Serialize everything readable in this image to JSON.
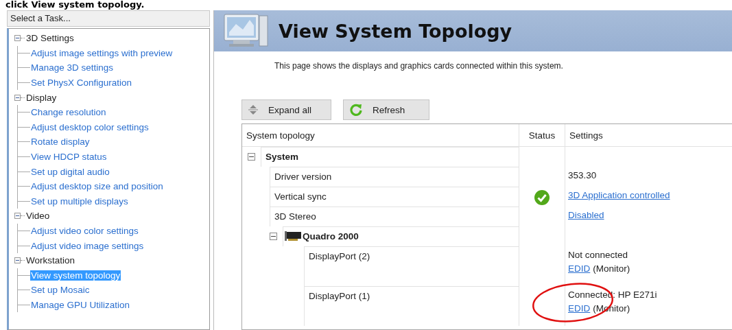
{
  "caption": "click View system topology.",
  "sidebar": {
    "title": "Select a Task...",
    "tree": [
      {
        "label": "3D Settings",
        "expanded": true,
        "children": [
          {
            "label": "Adjust image settings with preview",
            "selected": false
          },
          {
            "label": "Manage 3D settings",
            "selected": false
          },
          {
            "label": "Set PhysX Configuration",
            "selected": false
          }
        ]
      },
      {
        "label": "Display",
        "expanded": true,
        "children": [
          {
            "label": "Change resolution",
            "selected": false
          },
          {
            "label": "Adjust desktop color settings",
            "selected": false
          },
          {
            "label": "Rotate display",
            "selected": false
          },
          {
            "label": "View HDCP status",
            "selected": false
          },
          {
            "label": "Set up digital audio",
            "selected": false
          },
          {
            "label": "Adjust desktop size and position",
            "selected": false
          },
          {
            "label": "Set up multiple displays",
            "selected": false
          }
        ]
      },
      {
        "label": "Video",
        "expanded": true,
        "children": [
          {
            "label": "Adjust video color settings",
            "selected": false
          },
          {
            "label": "Adjust video image settings",
            "selected": false
          }
        ]
      },
      {
        "label": "Workstation",
        "expanded": true,
        "children": [
          {
            "label": "View system topology",
            "selected": true
          },
          {
            "label": "Set up Mosaic",
            "selected": false
          },
          {
            "label": "Manage GPU Utilization",
            "selected": false
          }
        ]
      }
    ]
  },
  "page": {
    "title": "View System Topology",
    "description": "This page shows the displays and graphics cards connected within this system."
  },
  "toolbar": [
    {
      "kind": "expand",
      "label": "Expand all"
    },
    {
      "kind": "refresh",
      "label": "Refresh"
    }
  ],
  "table": {
    "columns": [
      "System topology",
      "Status",
      "Settings"
    ],
    "rows": [
      {
        "kind": "system",
        "label": "System",
        "expanded": true,
        "children": [
          {
            "kind": "setting",
            "label": "Driver version",
            "status_ok": false,
            "settings": [
              [
                {
                  "kind": "text",
                  "text": "353.30"
                }
              ]
            ]
          },
          {
            "kind": "setting",
            "label": "Vertical sync",
            "status_ok": true,
            "settings": [
              [
                {
                  "kind": "link",
                  "text": "3D Application controlled"
                }
              ]
            ]
          },
          {
            "kind": "setting",
            "label": "3D Stereo",
            "status_ok": false,
            "settings": [
              [
                {
                  "kind": "link",
                  "text": "Disabled"
                }
              ]
            ]
          },
          {
            "kind": "gpu",
            "label": "Quadro 2000",
            "expanded": true,
            "children": [
              {
                "kind": "port",
                "label": "DisplayPort (2)",
                "status_ok": false,
                "settings": [
                  [
                    {
                      "kind": "text",
                      "text": "Not connected"
                    }
                  ],
                  [
                    {
                      "kind": "link",
                      "text": "EDID"
                    },
                    {
                      "kind": "text",
                      "text": "(Monitor)"
                    }
                  ]
                ]
              },
              {
                "kind": "port",
                "label": "DisplayPort (1)",
                "status_ok": false,
                "settings": [
                  [
                    {
                      "kind": "text",
                      "text": "Connected: HP E271i"
                    }
                  ],
                  [
                    {
                      "kind": "link",
                      "text": "EDID"
                    },
                    {
                      "kind": "text",
                      "text": "(Monitor)"
                    }
                  ]
                ]
              }
            ]
          }
        ]
      }
    ]
  }
}
